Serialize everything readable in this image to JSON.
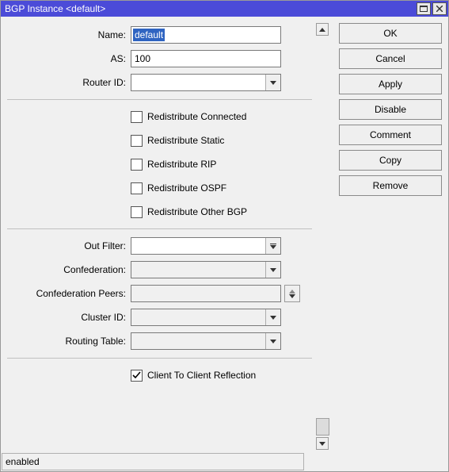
{
  "window": {
    "title": "BGP Instance <default>"
  },
  "buttons": {
    "ok": "OK",
    "cancel": "Cancel",
    "apply": "Apply",
    "disable": "Disable",
    "comment": "Comment",
    "copy": "Copy",
    "remove": "Remove"
  },
  "labels": {
    "name": "Name:",
    "as": "AS:",
    "router_id": "Router ID:",
    "out_filter": "Out Filter:",
    "confederation": "Confederation:",
    "confederation_peers": "Confederation Peers:",
    "cluster_id": "Cluster ID:",
    "routing_table": "Routing Table:"
  },
  "checkboxes": {
    "redistribute_connected": "Redistribute Connected",
    "redistribute_static": "Redistribute Static",
    "redistribute_rip": "Redistribute RIP",
    "redistribute_ospf": "Redistribute OSPF",
    "redistribute_other_bgp": "Redistribute Other BGP",
    "client_to_client": "Client To Client Reflection"
  },
  "values": {
    "name": "default",
    "as": "100",
    "router_id": "",
    "out_filter": "",
    "confederation": "",
    "confederation_peers": "",
    "cluster_id": "",
    "routing_table": ""
  },
  "checked": {
    "redistribute_connected": false,
    "redistribute_static": false,
    "redistribute_rip": false,
    "redistribute_ospf": false,
    "redistribute_other_bgp": false,
    "client_to_client": true
  },
  "status": {
    "text": "enabled"
  }
}
